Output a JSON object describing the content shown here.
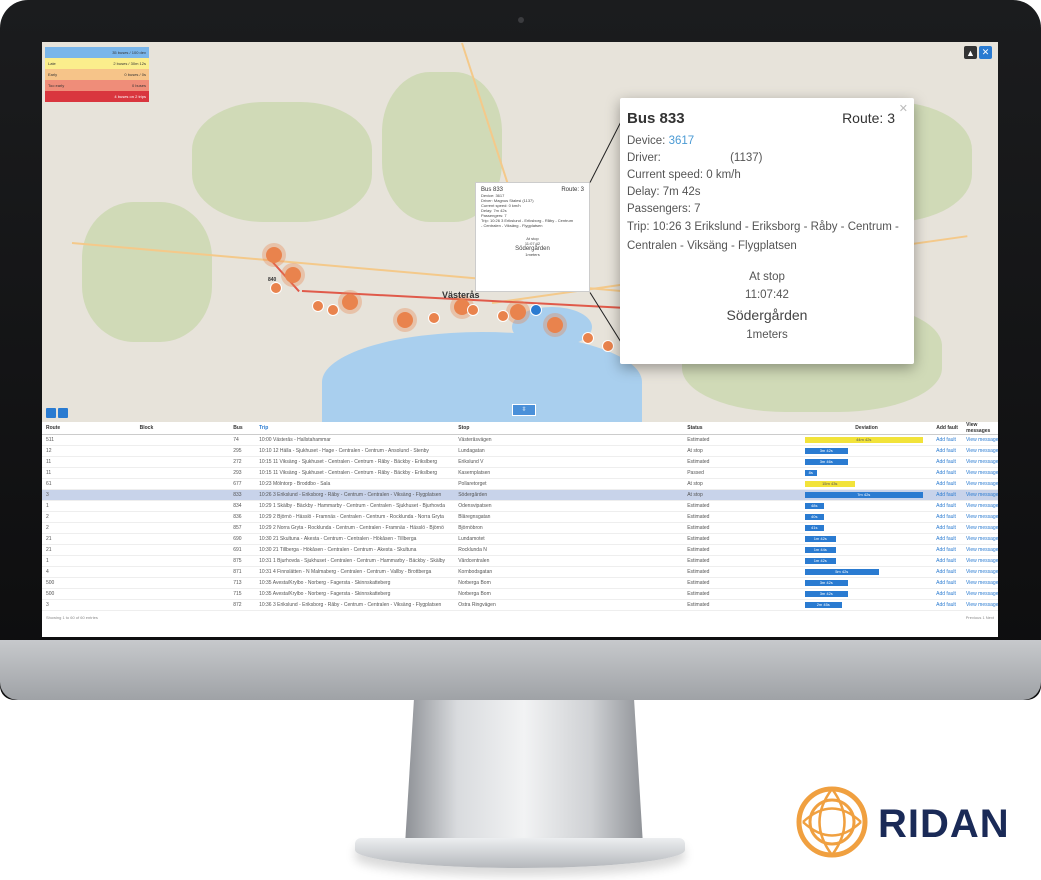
{
  "legend": [
    {
      "label": "",
      "value": "35 buses / 100 dev",
      "color": "#7ab6ea"
    },
    {
      "label": "Late",
      "value": "2 buses / 30m 12s",
      "color": "#fbee8c"
    },
    {
      "label": "Early",
      "value": "0 buses / 0s",
      "color": "#f6c489"
    },
    {
      "label": "Too early",
      "value": "0 buses",
      "color": "#ef8d79"
    },
    {
      "label": "",
      "value": "4 buses on 2 trips",
      "color": "#d9363e"
    }
  ],
  "map": {
    "city": "Västerås",
    "cluster_label": "840",
    "buttons": [
      "person-icon",
      "close-icon"
    ],
    "colors": {
      "route": "#e05a4a",
      "cluster": "#e9834d",
      "water": "#a9cfee"
    }
  },
  "mini_popup": {
    "title": "Bus 833",
    "route": "Route: 3",
    "lines": [
      "Device: 3617",
      "Driver: Magnus Stalesi (1137)",
      "Current speed: 0 km/h",
      "Delay: 7m 42s",
      "Passengers: 7",
      "Trip: 10:26 3 Erikslund - Eriksborg - Råby - Centrum",
      "- Centralen - Viksäng - Flygplatsen"
    ],
    "stop": [
      "At stop",
      "11:07:42",
      "Södergården",
      "1meters"
    ]
  },
  "popup": {
    "title": "Bus 833",
    "route": "Route: 3",
    "device_label": "Device:",
    "device_value": "3617",
    "driver_label": "Driver:",
    "driver_value": "(1137)",
    "speed": "Current speed: 0 km/h",
    "delay": "Delay: 7m 42s",
    "passengers": "Passengers: 7",
    "trip": "Trip: 10:26 3 Erikslund - Eriksborg - Råby - Centrum - Centralen - Viksäng - Flygplatsen",
    "at_stop": "At stop",
    "time": "11:07:42",
    "stop_name": "Södergården",
    "distance": "1meters"
  },
  "table": {
    "headers": {
      "route": "Route",
      "block": "Block",
      "bus": "Bus",
      "trip": "Trip",
      "stop": "Stop",
      "status": "Status",
      "deviation": "Deviation",
      "fault": "Add fault",
      "messages": "View messages"
    },
    "rows": [
      {
        "route": "511",
        "block": "",
        "bus": "74",
        "trip": "10:00 Västerås - Hallstahammar",
        "stop": "Västeråsvägen",
        "status": "Estimated",
        "dev": "44m 42s",
        "dev_frac": 0.95,
        "dev_color": "yellow"
      },
      {
        "route": "12",
        "block": "",
        "bus": "295",
        "trip": "10:10 12 Hälla - Sjukhuset - Hage - Centralen - Centrum - Ansolund - Stenby",
        "stop": "Lundagatan",
        "status": "At stop",
        "dev": "3m 42s",
        "dev_frac": 0.35,
        "dev_color": "blue"
      },
      {
        "route": "11",
        "block": "",
        "bus": "272",
        "trip": "10:15 11 Viksäng - Sjukhuset - Centralen - Centrum - Råby - Bäckby - Erikslberg",
        "stop": "Erikslund V",
        "status": "Estimated",
        "dev": "3m 46s",
        "dev_frac": 0.35,
        "dev_color": "blue"
      },
      {
        "route": "11",
        "block": "",
        "bus": "293",
        "trip": "10:15 11 Viksäng - Sjukhuset - Centralen - Centrum - Råby - Bäckby - Erikslberg",
        "stop": "Kasernplatsen",
        "status": "Passed",
        "dev": "8s",
        "dev_frac": 0.1,
        "dev_color": "blue"
      },
      {
        "route": "61",
        "block": "",
        "bus": "677",
        "trip": "10:23 Mölntorp - Broddbo - Sala",
        "stop": "Pollaretorget",
        "status": "At stop",
        "dev": "15m 43s",
        "dev_frac": 0.4,
        "dev_color": "yellow"
      },
      {
        "route": "3",
        "block": "",
        "bus": "833",
        "trip": "10:26 3 Erikslund - Eriksborg - Råby - Centrum - Centralen - Viksäng - Flygplatsen",
        "stop": "Södergården",
        "status": "At stop",
        "dev": "7m 42s",
        "dev_frac": 0.95,
        "dev_color": "blue",
        "selected": true
      },
      {
        "route": "1",
        "block": "",
        "bus": "834",
        "trip": "10:29 1 Skälby - Bäckby - Hammarby - Centrum - Centralen - Sjukhuset - Bjurhovda",
        "stop": "Odensvipatsen",
        "status": "Estimated",
        "dev": "48s",
        "dev_frac": 0.15,
        "dev_color": "blue"
      },
      {
        "route": "2",
        "block": "",
        "bus": "836",
        "trip": "10:29 2 Björnö - Hässlö - Framnäs - Centralen - Centrum - Rocklunda - Norra Gryta",
        "stop": "Blåregnsgatan",
        "status": "Estimated",
        "dev": "40s",
        "dev_frac": 0.15,
        "dev_color": "blue"
      },
      {
        "route": "2",
        "block": "",
        "bus": "857",
        "trip": "10:29 2 Norra Gryta - Rocklunda - Centrum - Centralen - Framnäs - Hässlö - Björnö",
        "stop": "Björnöbron",
        "status": "Estimated",
        "dev": "41s",
        "dev_frac": 0.15,
        "dev_color": "blue"
      },
      {
        "route": "21",
        "block": "",
        "bus": "690",
        "trip": "10:30 21 Skultuna - Åkesta - Centrum - Centralen - Hökåsen - Tillberga",
        "stop": "Lundamotet",
        "status": "Estimated",
        "dev": "1m 42s",
        "dev_frac": 0.25,
        "dev_color": "blue"
      },
      {
        "route": "21",
        "block": "",
        "bus": "691",
        "trip": "10:30 21 Tillberga - Hökåsen - Centralen - Centrum - Åkesta - Skultuna",
        "stop": "Rocklunda N",
        "status": "Estimated",
        "dev": "1m 44s",
        "dev_frac": 0.25,
        "dev_color": "blue"
      },
      {
        "route": "1",
        "block": "",
        "bus": "875",
        "trip": "10:31 1 Bjurhovda - Sjukhuset - Centralen - Centrum - Hammarby - Bäckby - Skälby",
        "stop": "Vårdcentralen",
        "status": "Estimated",
        "dev": "1m 42s",
        "dev_frac": 0.25,
        "dev_color": "blue"
      },
      {
        "route": "4",
        "block": "",
        "bus": "871",
        "trip": "10:31 4 Finnslätten - N Malmaberg - Centralen - Centrum - Vallby - Brottberga",
        "stop": "Kornbodsgatan",
        "status": "Estimated",
        "dev": "5m 42s",
        "dev_frac": 0.6,
        "dev_color": "blue"
      },
      {
        "route": "500",
        "block": "",
        "bus": "713",
        "trip": "10:35 Avesta/Krylbo - Norberg - Fagersta - Skinnskatteberg",
        "stop": "Norberga Bom",
        "status": "Estimated",
        "dev": "3m 42s",
        "dev_frac": 0.35,
        "dev_color": "blue"
      },
      {
        "route": "500",
        "block": "",
        "bus": "715",
        "trip": "10:35 Avesta/Krylbo - Norberg - Fagersta - Skinnskatteberg",
        "stop": "Norberga Bom",
        "status": "Estimated",
        "dev": "3m 42s",
        "dev_frac": 0.35,
        "dev_color": "blue"
      },
      {
        "route": "3",
        "block": "",
        "bus": "872",
        "trip": "10:36 3 Erikslund - Eriksborg - Råby - Centrum - Centralen - Viksäng - Flygplatsen",
        "stop": "Östra Ringvägen",
        "status": "Estimated",
        "dev": "2m 45s",
        "dev_frac": 0.3,
        "dev_color": "blue"
      }
    ],
    "row_fault": "Add fault",
    "row_messages": "View messages",
    "footer_info": "Showing 1 to 60 of 60 entries",
    "pager": "Previous   1   Next"
  },
  "brand": "RIDAN",
  "colors": {
    "accent": "#2a7bd1",
    "bezel": "#111213",
    "brand": "#1a2a57",
    "logo": "#f0a040"
  }
}
